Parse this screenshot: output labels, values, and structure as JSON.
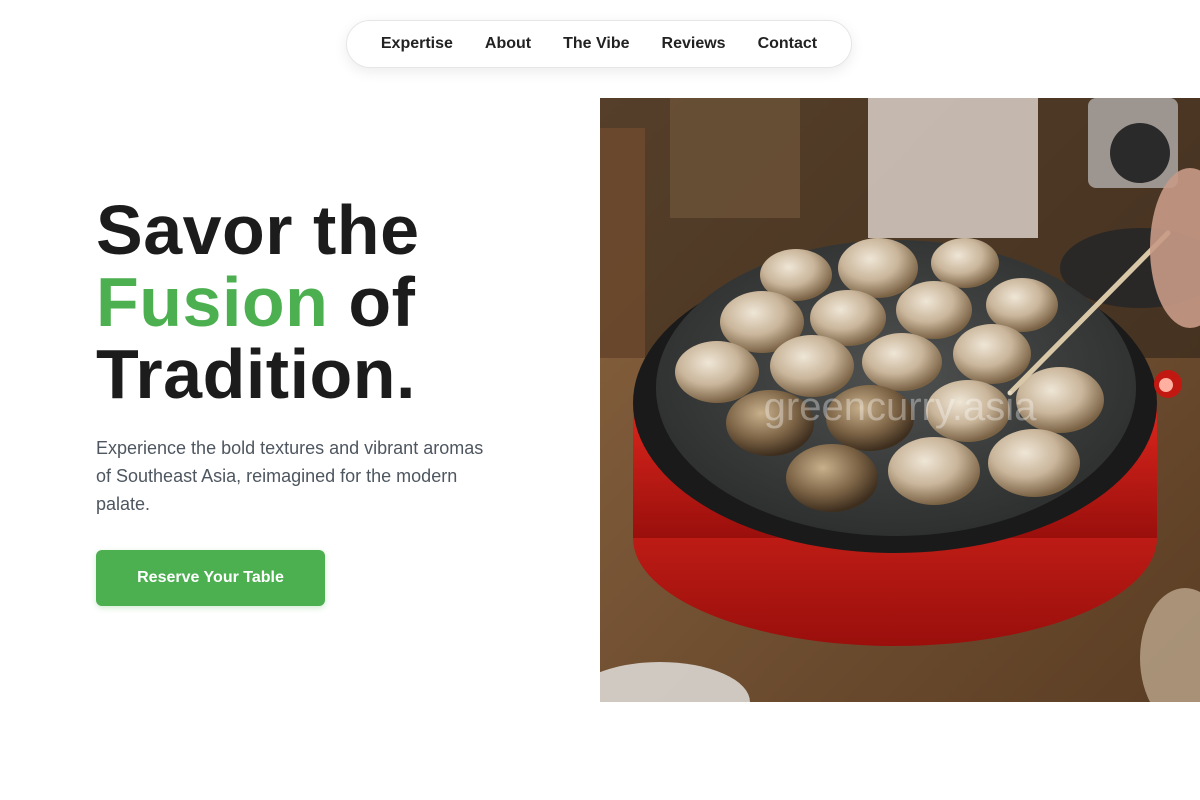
{
  "nav": {
    "items": [
      {
        "label": "Expertise"
      },
      {
        "label": "About"
      },
      {
        "label": "The Vibe"
      },
      {
        "label": "Reviews"
      },
      {
        "label": "Contact"
      }
    ]
  },
  "hero": {
    "headline": {
      "line1": "Savor the",
      "accent": "Fusion",
      "line2_rest": " of",
      "line3": "Tradition."
    },
    "subtext": "Experience the bold textures and vibrant aromas of Southeast Asia, reimagined for the modern palate.",
    "cta_label": "Reserve Your Table",
    "image": {
      "watermark": "greencurry.asia",
      "subject": "takoyaki-pan-photo"
    }
  },
  "colors": {
    "accent": "#4caf50",
    "text": "#1c1c1c",
    "muted": "#4e5660"
  }
}
